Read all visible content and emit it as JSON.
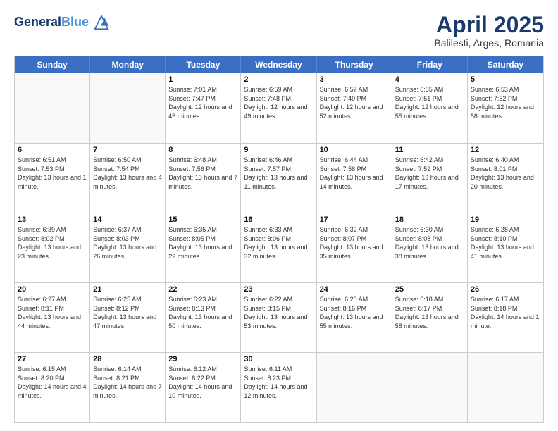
{
  "header": {
    "logo_line1": "General",
    "logo_line2": "Blue",
    "month": "April 2025",
    "location": "Balilesti, Arges, Romania"
  },
  "weekdays": [
    "Sunday",
    "Monday",
    "Tuesday",
    "Wednesday",
    "Thursday",
    "Friday",
    "Saturday"
  ],
  "weeks": [
    [
      {
        "day": null
      },
      {
        "day": null
      },
      {
        "day": "1",
        "sunrise": "Sunrise: 7:01 AM",
        "sunset": "Sunset: 7:47 PM",
        "daylight": "Daylight: 12 hours and 46 minutes."
      },
      {
        "day": "2",
        "sunrise": "Sunrise: 6:59 AM",
        "sunset": "Sunset: 7:48 PM",
        "daylight": "Daylight: 12 hours and 49 minutes."
      },
      {
        "day": "3",
        "sunrise": "Sunrise: 6:57 AM",
        "sunset": "Sunset: 7:49 PM",
        "daylight": "Daylight: 12 hours and 52 minutes."
      },
      {
        "day": "4",
        "sunrise": "Sunrise: 6:55 AM",
        "sunset": "Sunset: 7:51 PM",
        "daylight": "Daylight: 12 hours and 55 minutes."
      },
      {
        "day": "5",
        "sunrise": "Sunrise: 6:53 AM",
        "sunset": "Sunset: 7:52 PM",
        "daylight": "Daylight: 12 hours and 58 minutes."
      }
    ],
    [
      {
        "day": "6",
        "sunrise": "Sunrise: 6:51 AM",
        "sunset": "Sunset: 7:53 PM",
        "daylight": "Daylight: 13 hours and 1 minute."
      },
      {
        "day": "7",
        "sunrise": "Sunrise: 6:50 AM",
        "sunset": "Sunset: 7:54 PM",
        "daylight": "Daylight: 13 hours and 4 minutes."
      },
      {
        "day": "8",
        "sunrise": "Sunrise: 6:48 AM",
        "sunset": "Sunset: 7:56 PM",
        "daylight": "Daylight: 13 hours and 7 minutes."
      },
      {
        "day": "9",
        "sunrise": "Sunrise: 6:46 AM",
        "sunset": "Sunset: 7:57 PM",
        "daylight": "Daylight: 13 hours and 11 minutes."
      },
      {
        "day": "10",
        "sunrise": "Sunrise: 6:44 AM",
        "sunset": "Sunset: 7:58 PM",
        "daylight": "Daylight: 13 hours and 14 minutes."
      },
      {
        "day": "11",
        "sunrise": "Sunrise: 6:42 AM",
        "sunset": "Sunset: 7:59 PM",
        "daylight": "Daylight: 13 hours and 17 minutes."
      },
      {
        "day": "12",
        "sunrise": "Sunrise: 6:40 AM",
        "sunset": "Sunset: 8:01 PM",
        "daylight": "Daylight: 13 hours and 20 minutes."
      }
    ],
    [
      {
        "day": "13",
        "sunrise": "Sunrise: 6:39 AM",
        "sunset": "Sunset: 8:02 PM",
        "daylight": "Daylight: 13 hours and 23 minutes."
      },
      {
        "day": "14",
        "sunrise": "Sunrise: 6:37 AM",
        "sunset": "Sunset: 8:03 PM",
        "daylight": "Daylight: 13 hours and 26 minutes."
      },
      {
        "day": "15",
        "sunrise": "Sunrise: 6:35 AM",
        "sunset": "Sunset: 8:05 PM",
        "daylight": "Daylight: 13 hours and 29 minutes."
      },
      {
        "day": "16",
        "sunrise": "Sunrise: 6:33 AM",
        "sunset": "Sunset: 8:06 PM",
        "daylight": "Daylight: 13 hours and 32 minutes."
      },
      {
        "day": "17",
        "sunrise": "Sunrise: 6:32 AM",
        "sunset": "Sunset: 8:07 PM",
        "daylight": "Daylight: 13 hours and 35 minutes."
      },
      {
        "day": "18",
        "sunrise": "Sunrise: 6:30 AM",
        "sunset": "Sunset: 8:08 PM",
        "daylight": "Daylight: 13 hours and 38 minutes."
      },
      {
        "day": "19",
        "sunrise": "Sunrise: 6:28 AM",
        "sunset": "Sunset: 8:10 PM",
        "daylight": "Daylight: 13 hours and 41 minutes."
      }
    ],
    [
      {
        "day": "20",
        "sunrise": "Sunrise: 6:27 AM",
        "sunset": "Sunset: 8:11 PM",
        "daylight": "Daylight: 13 hours and 44 minutes."
      },
      {
        "day": "21",
        "sunrise": "Sunrise: 6:25 AM",
        "sunset": "Sunset: 8:12 PM",
        "daylight": "Daylight: 13 hours and 47 minutes."
      },
      {
        "day": "22",
        "sunrise": "Sunrise: 6:23 AM",
        "sunset": "Sunset: 8:13 PM",
        "daylight": "Daylight: 13 hours and 50 minutes."
      },
      {
        "day": "23",
        "sunrise": "Sunrise: 6:22 AM",
        "sunset": "Sunset: 8:15 PM",
        "daylight": "Daylight: 13 hours and 53 minutes."
      },
      {
        "day": "24",
        "sunrise": "Sunrise: 6:20 AM",
        "sunset": "Sunset: 8:16 PM",
        "daylight": "Daylight: 13 hours and 55 minutes."
      },
      {
        "day": "25",
        "sunrise": "Sunrise: 6:18 AM",
        "sunset": "Sunset: 8:17 PM",
        "daylight": "Daylight: 13 hours and 58 minutes."
      },
      {
        "day": "26",
        "sunrise": "Sunrise: 6:17 AM",
        "sunset": "Sunset: 8:18 PM",
        "daylight": "Daylight: 14 hours and 1 minute."
      }
    ],
    [
      {
        "day": "27",
        "sunrise": "Sunrise: 6:15 AM",
        "sunset": "Sunset: 8:20 PM",
        "daylight": "Daylight: 14 hours and 4 minutes."
      },
      {
        "day": "28",
        "sunrise": "Sunrise: 6:14 AM",
        "sunset": "Sunset: 8:21 PM",
        "daylight": "Daylight: 14 hours and 7 minutes."
      },
      {
        "day": "29",
        "sunrise": "Sunrise: 6:12 AM",
        "sunset": "Sunset: 8:22 PM",
        "daylight": "Daylight: 14 hours and 10 minutes."
      },
      {
        "day": "30",
        "sunrise": "Sunrise: 6:11 AM",
        "sunset": "Sunset: 8:23 PM",
        "daylight": "Daylight: 14 hours and 12 minutes."
      },
      {
        "day": null
      },
      {
        "day": null
      },
      {
        "day": null
      }
    ]
  ]
}
